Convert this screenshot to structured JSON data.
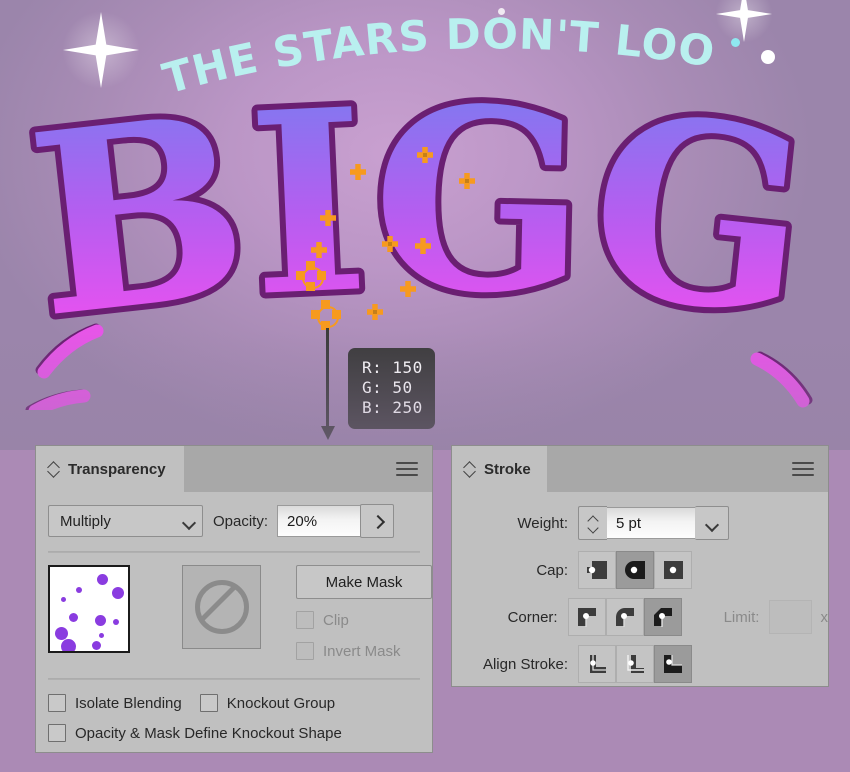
{
  "artwork": {
    "headline": "THE STARS DON'T LOOK",
    "word": "BIGGER",
    "tooltip": {
      "r": "R: 150",
      "g": "G: 50",
      "b": "B: 250"
    }
  },
  "transparency_panel": {
    "title": "Transparency",
    "menu_icon": "hamburger-menu-icon",
    "collapse_icon": "double-chevron-icon",
    "blend_mode": {
      "value": "Multiply",
      "dropdown_icon": "chevron-down-icon"
    },
    "opacity": {
      "label": "Opacity:",
      "value": "20%",
      "expand_icon": "chevron-right-icon"
    },
    "make_mask_button": "Make Mask",
    "clip": {
      "label": "Clip",
      "checked": false,
      "disabled": true
    },
    "invert_mask": {
      "label": "Invert Mask",
      "checked": false,
      "disabled": true
    },
    "isolate_blending": {
      "label": "Isolate Blending",
      "checked": false
    },
    "knockout_group": {
      "label": "Knockout Group",
      "checked": false
    },
    "opacity_mask_knockout": {
      "label": "Opacity & Mask Define Knockout Shape",
      "checked": false
    },
    "mask_placeholder_icon": "no-mask-icon"
  },
  "stroke_panel": {
    "title": "Stroke",
    "menu_icon": "hamburger-menu-icon",
    "collapse_icon": "double-chevron-icon",
    "weight": {
      "label": "Weight:",
      "value": "5 pt",
      "stepper_icon": "up-down-stepper-icon",
      "dropdown_icon": "chevron-down-icon"
    },
    "cap": {
      "label": "Cap:",
      "options": [
        "butt-cap",
        "round-cap",
        "projecting-cap"
      ],
      "selected": 1
    },
    "corner": {
      "label": "Corner:",
      "options": [
        "miter-join",
        "round-join",
        "bevel-join"
      ],
      "selected": 2
    },
    "align_stroke": {
      "label": "Align Stroke:",
      "options": [
        "align-center",
        "align-inside",
        "align-outside"
      ],
      "selected": 2
    },
    "limit": {
      "label": "Limit:",
      "value": "",
      "suffix": "x",
      "disabled": true
    }
  },
  "colors": {
    "panel_bg": "#c0c0c0",
    "panel_header": "#a8a8a8",
    "canvas_bg": "#ab8ab5",
    "headline_text": "#b9f0ef",
    "anchor_marker": "#f79a1e",
    "letter_outline": "#6a1f72",
    "tooltip_bg": "#3a3a3a"
  }
}
